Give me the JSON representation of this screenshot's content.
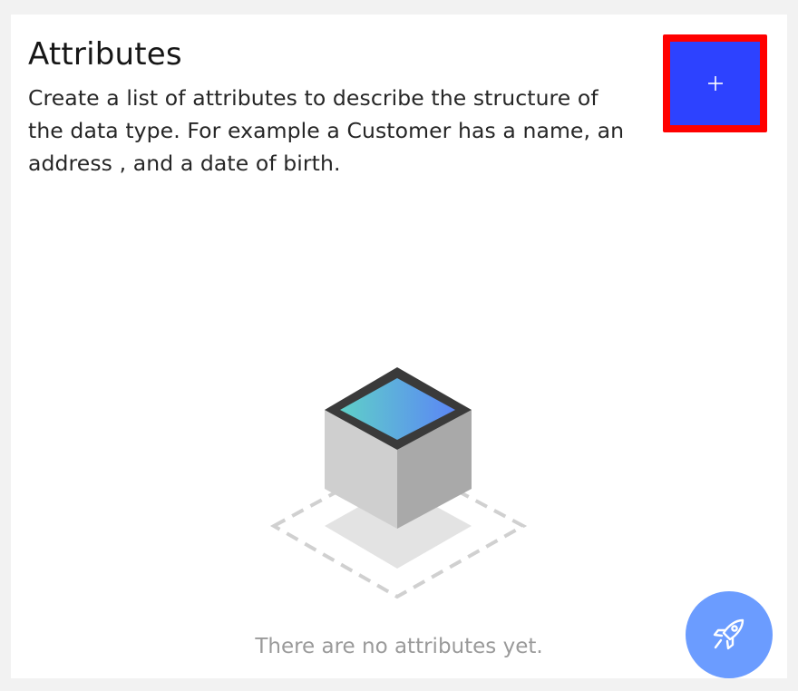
{
  "panel": {
    "title": "Attributes",
    "description": "Create a list of attributes to describe the structure of the data type. For example a Customer has a name, an address , and a date of birth."
  },
  "add_button": {
    "icon": "plus-icon",
    "accent_color": "#2d42ff",
    "highlight_color": "#ff0000"
  },
  "empty_state": {
    "illustration": "empty-box-illustration",
    "message": "There are no attributes yet."
  },
  "fab": {
    "icon": "rocket-icon",
    "color": "#6b9cff"
  }
}
